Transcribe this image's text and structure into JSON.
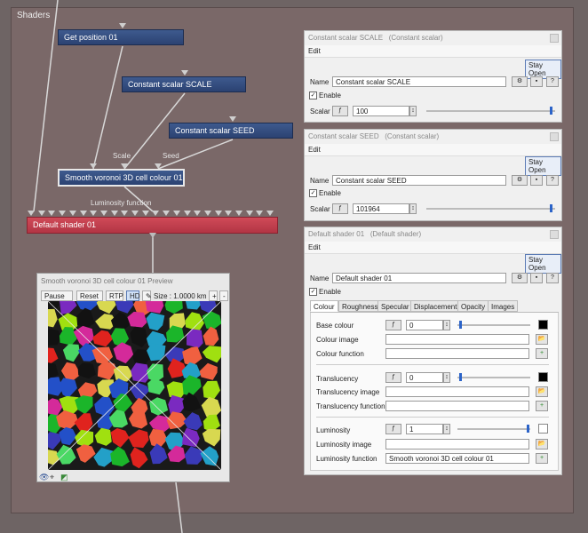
{
  "panel_title": "Shaders",
  "nodes": {
    "get_position": "Get position 01",
    "scale": "Constant scalar SCALE",
    "seed": "Constant scalar SEED",
    "voronoi": "Smooth voronoi 3D cell colour 01",
    "default_shader": "Default shader 01"
  },
  "port_labels": {
    "scale": "Scale",
    "seed": "Seed",
    "luminosity": "Luminosity function"
  },
  "prop_scale": {
    "title": "Constant scalar SCALE",
    "type": "(Constant scalar)",
    "menu": "Edit",
    "stay_open": "Stay Open",
    "name_label": "Name",
    "name_value": "Constant scalar SCALE",
    "enable_label": "Enable",
    "scalar_label": "Scalar",
    "scalar_value": "100",
    "help": "?"
  },
  "prop_seed": {
    "title": "Constant scalar SEED",
    "type": "(Constant scalar)",
    "menu": "Edit",
    "stay_open": "Stay Open",
    "name_label": "Name",
    "name_value": "Constant scalar SEED",
    "enable_label": "Enable",
    "scalar_label": "Scalar",
    "scalar_value": "101964",
    "help": "?"
  },
  "prop_shader": {
    "title": "Default shader 01",
    "type": "(Default shader)",
    "menu": "Edit",
    "stay_open": "Stay Open",
    "name_label": "Name",
    "name_value": "Default shader 01",
    "enable_label": "Enable",
    "help": "?",
    "tabs": [
      "Colour",
      "Roughness",
      "Specular",
      "Displacement",
      "Opacity",
      "Images"
    ],
    "base_colour_label": "Base colour",
    "base_colour_value": "0",
    "colour_image_label": "Colour image",
    "colour_function_label": "Colour function",
    "translucency_label": "Translucency",
    "translucency_value": "0",
    "translucency_image_label": "Translucency image",
    "translucency_function_label": "Translucency function",
    "luminosity_label": "Luminosity",
    "luminosity_value": "1",
    "luminosity_image_label": "Luminosity image",
    "luminosity_function_label": "Luminosity function",
    "luminosity_function_value": "Smooth voronoi 3D cell colour 01"
  },
  "preview": {
    "title": "Smooth voronoi 3D cell colour 01 Preview",
    "pause": "Pause",
    "reset": "Reset",
    "rtp": "RTP",
    "hd": "HD",
    "size": "Size : 1.0000 km",
    "plus": "+",
    "minus": "-"
  }
}
